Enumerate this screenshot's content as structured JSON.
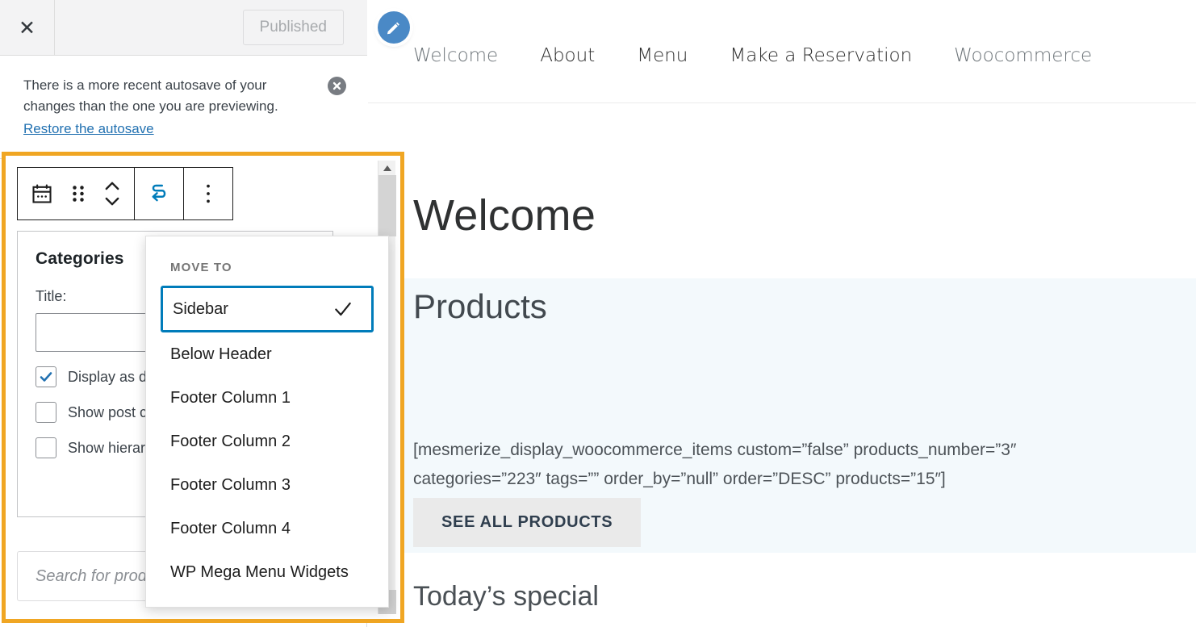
{
  "customizer": {
    "close_icon": "close-icon",
    "publish_button": "Published",
    "notice": {
      "message": "There is a more recent autosave of your changes than the one you are previewing.",
      "link": "Restore the autosave",
      "dismiss_icon": "dismiss-circle-icon"
    },
    "block_toolbar": {
      "block_type_icon": "calendar-block-icon",
      "drag_icon": "drag-handle-icon",
      "move_up_down_icon": "chevron-up-down-icon",
      "move_to_icon": "move-to-arrow-icon",
      "more_options_icon": "three-dots-vertical-icon"
    },
    "widget": {
      "title": "Categories",
      "title_field_label": "Title:",
      "title_field_value": "",
      "options": [
        {
          "label": "Display as dropdown",
          "checked": true
        },
        {
          "label": "Show post counts",
          "checked": false
        },
        {
          "label": "Show hierarchy",
          "checked": false
        }
      ]
    },
    "search": {
      "placeholder": "Search for products..."
    }
  },
  "move_to_menu": {
    "heading": "MOVE TO",
    "items": [
      {
        "label": "Sidebar",
        "selected": true
      },
      {
        "label": "Below Header",
        "selected": false
      },
      {
        "label": "Footer Column 1",
        "selected": false
      },
      {
        "label": "Footer Column 2",
        "selected": false
      },
      {
        "label": "Footer Column 3",
        "selected": false
      },
      {
        "label": "Footer Column 4",
        "selected": false
      },
      {
        "label": "WP Mega Menu Widgets",
        "selected": false
      }
    ],
    "check_icon": "checkmark-icon"
  },
  "preview": {
    "edit_icon": "pencil-edit-icon",
    "nav": [
      {
        "label": "Welcome",
        "muted": true
      },
      {
        "label": "About",
        "muted": false
      },
      {
        "label": "Menu",
        "muted": false
      },
      {
        "label": "Make a Reservation",
        "muted": false
      },
      {
        "label": "Woocommerce",
        "muted": true
      }
    ],
    "page_title": "Welcome",
    "products": {
      "heading": "Products",
      "shortcode": "[mesmerize_display_woocommerce_items custom=”false” products_number=”3″ categories=”223″ tags=”” order_by=”null” order=”DESC” products=”15″]",
      "button": "SEE ALL PRODUCTS"
    },
    "todays_special": "Today’s special"
  },
  "colors": {
    "highlight_orange": "#f0a623",
    "accent_blue": "#007cba",
    "products_bg": "#f3f9fc",
    "fab_blue": "#4a89c6"
  }
}
